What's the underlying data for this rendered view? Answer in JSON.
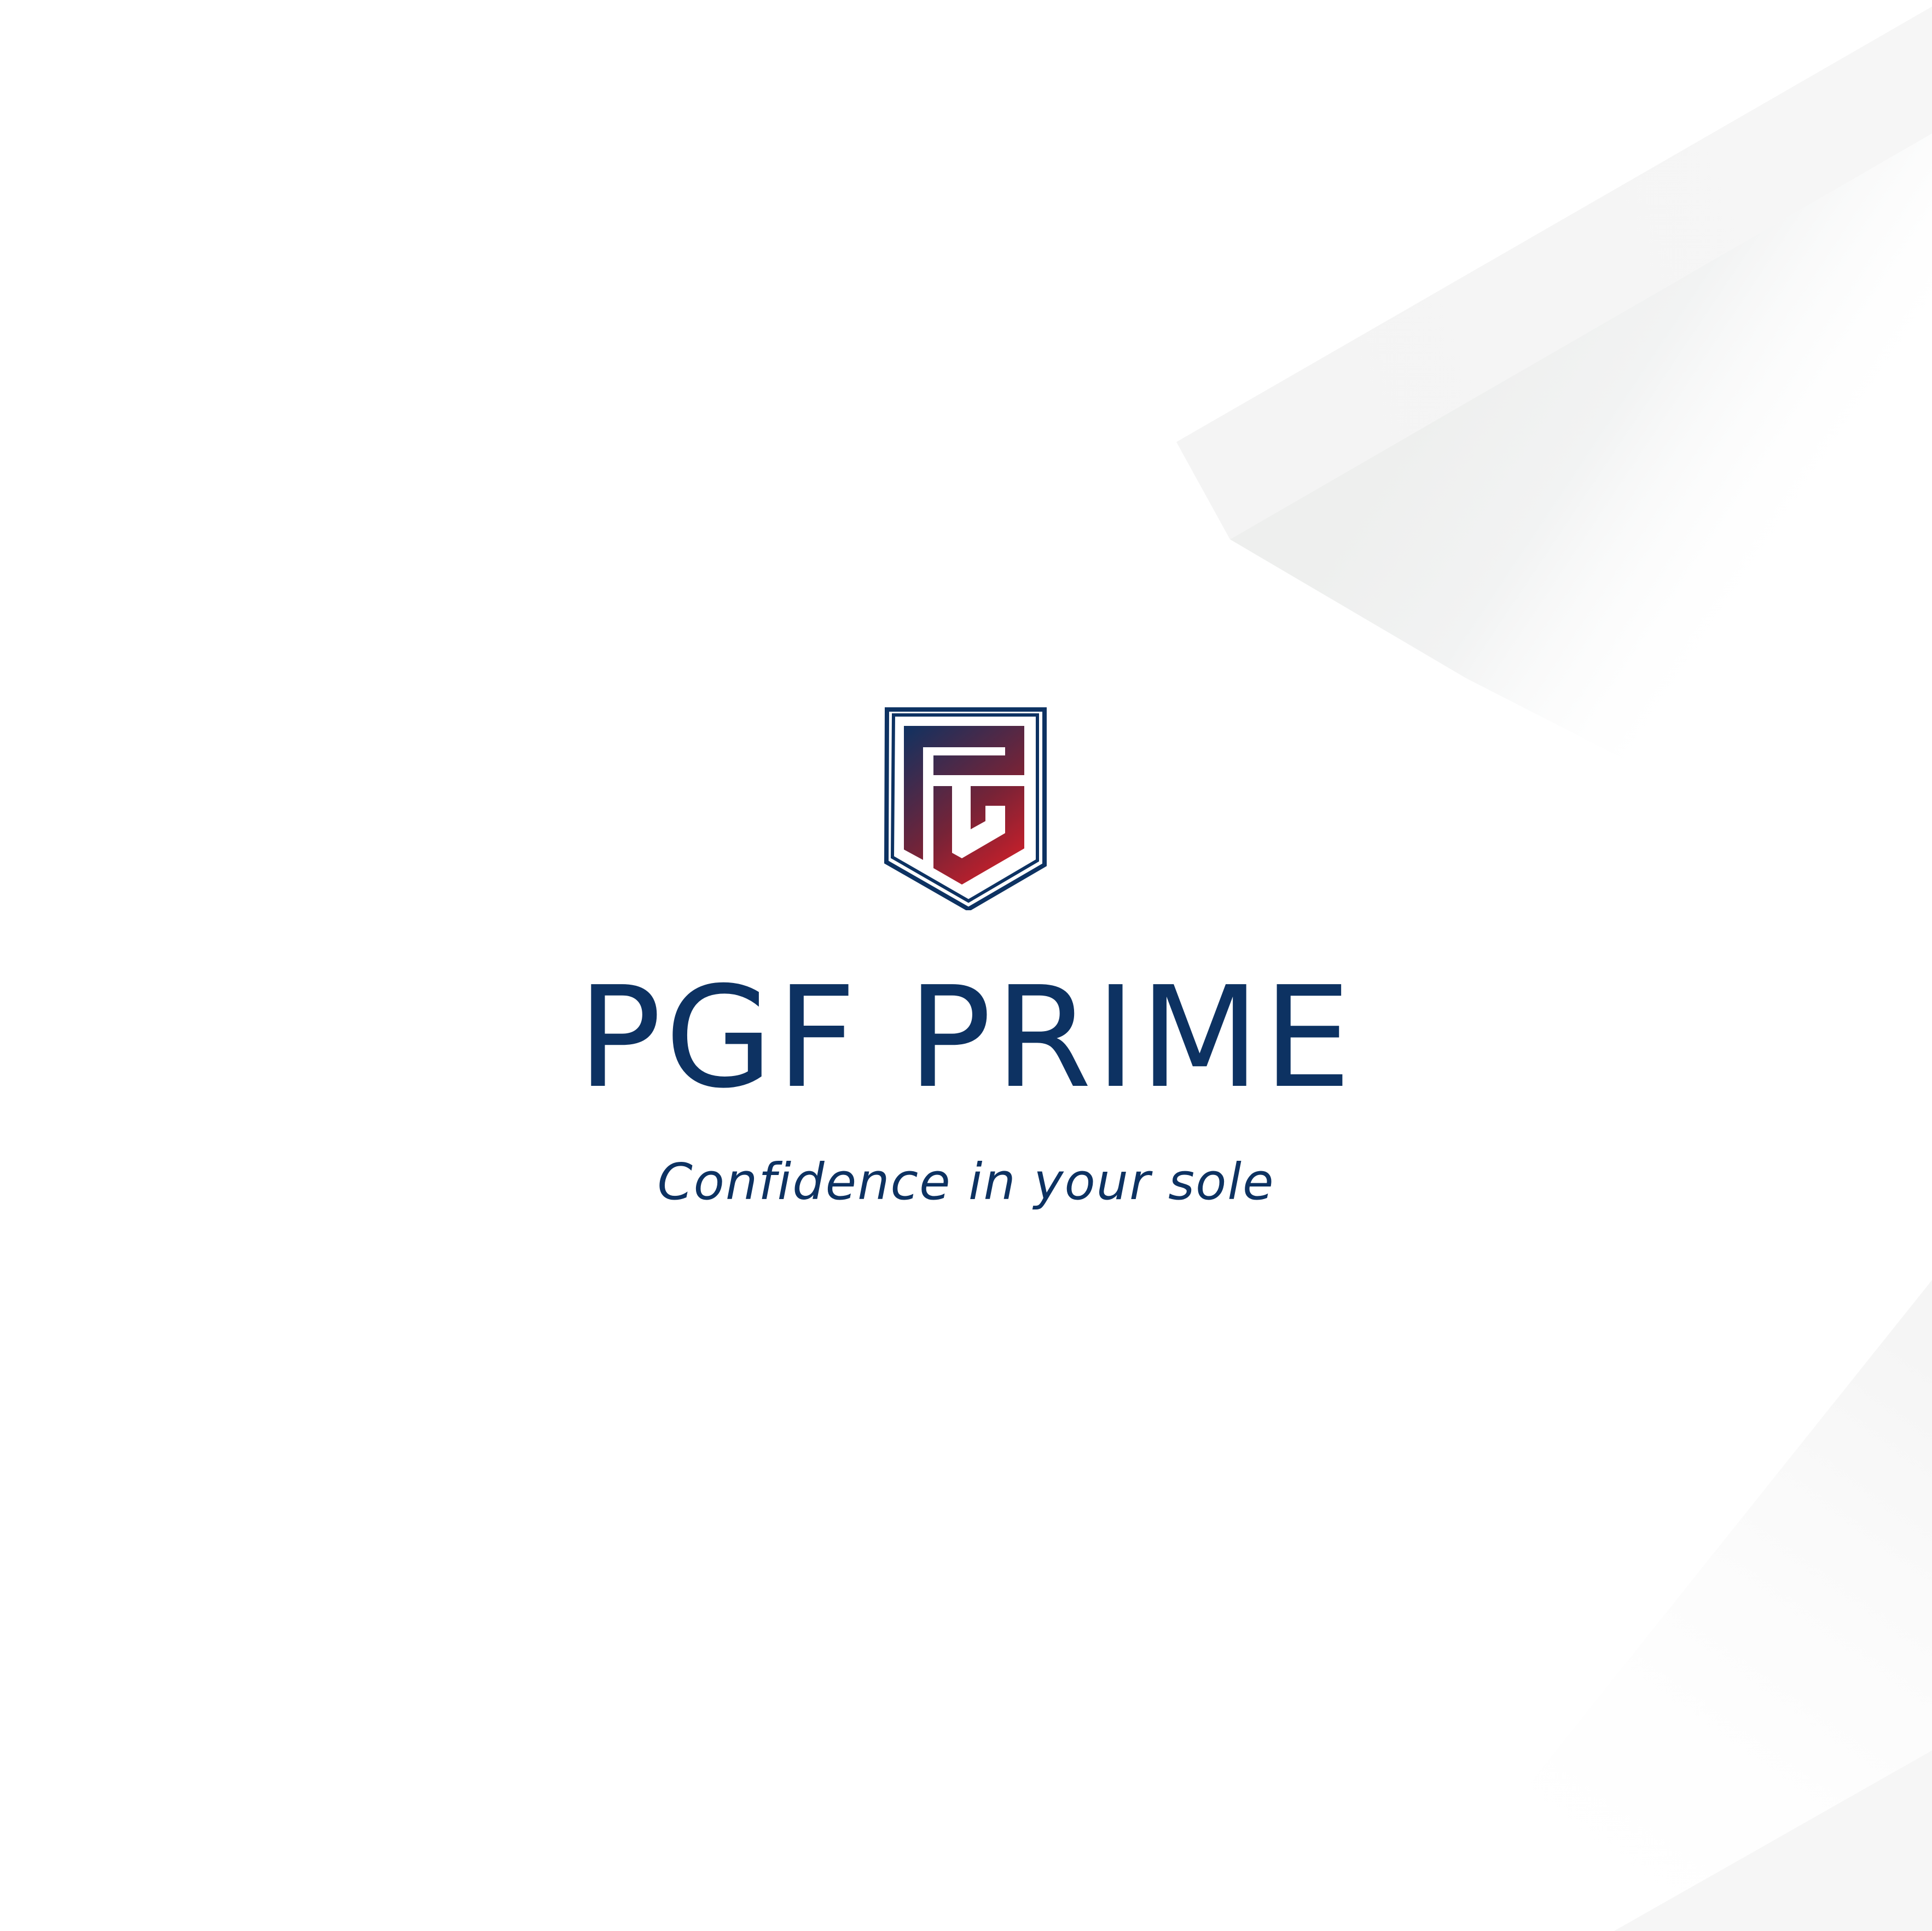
{
  "brand": {
    "name": "PGF PRIME",
    "tagline": "Confidence in your sole"
  },
  "logo": {
    "icon": "pgf-shield-monogram-icon"
  },
  "colors": {
    "navy": "#0d3262",
    "red": "#d9222a",
    "background": "#ffffff",
    "decor_gray": "#ebedec"
  }
}
